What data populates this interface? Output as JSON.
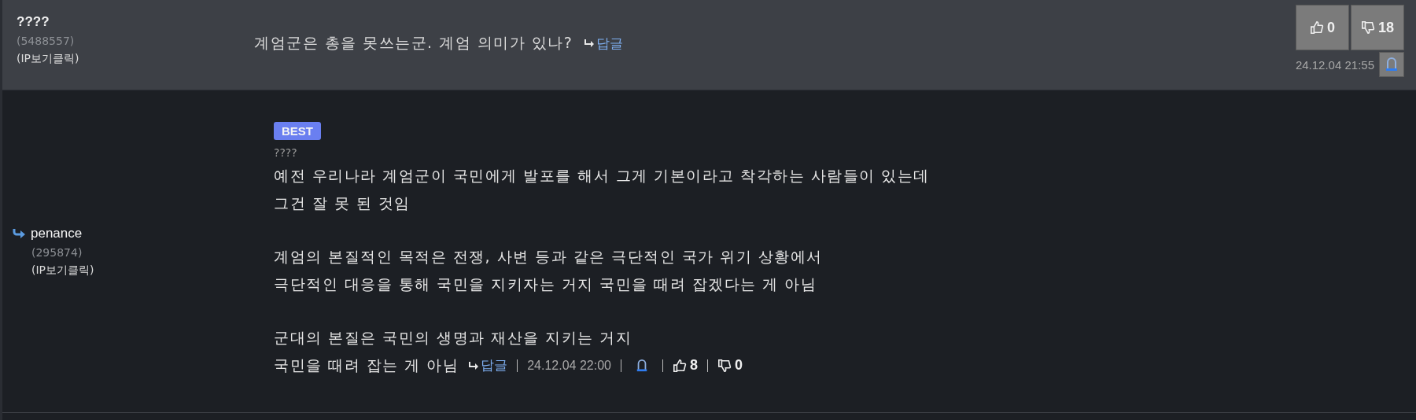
{
  "comments": [
    {
      "kind": "plain",
      "author": "????",
      "user_id": "(5488557)",
      "ip_link": "(IP보기클릭)",
      "paragraphs": [
        [
          "계엄군은 총을 못쓰는군. 계엄 의미가 있나?"
        ]
      ],
      "reply_link": "답글",
      "likes": "0",
      "dislikes": "18",
      "date": "24.12.04 21:55"
    },
    {
      "kind": "reply",
      "author": "penance",
      "user_id": "(295874)",
      "ip_link": "(IP보기클릭)",
      "best": true,
      "best_label": "BEST",
      "title": "????",
      "paragraphs": [
        [
          "예전 우리나라 계엄군이 국민에게 발포를 해서 그게 기본이라고 착각하는 사람들이 있는데",
          "그건 잘 못 된 것임"
        ],
        [
          "계엄의 본질적인 목적은 전쟁, 사변 등과 같은 극단적인 국가 위기 상황에서",
          "극단적인 대응을 통해 국민을 지키자는 거지 국민을 때려 잡겠다는 게 아님"
        ],
        [
          "군대의 본질은 국민의 생명과 재산을 지키는 거지",
          "국민을 때려 잡는 게 아님"
        ]
      ],
      "reply_link": "답글",
      "likes": "8",
      "dislikes": "0",
      "date": "24.12.04 22:00"
    }
  ]
}
